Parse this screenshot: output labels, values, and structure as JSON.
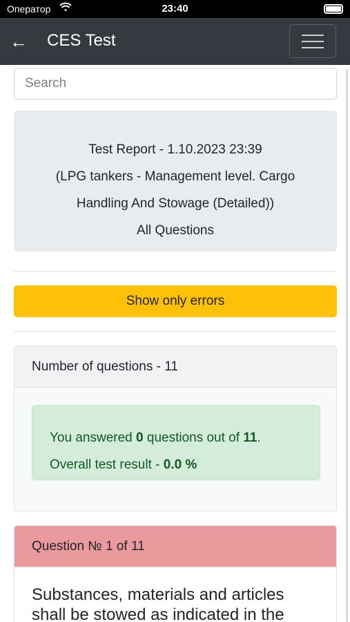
{
  "status_bar": {
    "carrier": "Оператор",
    "time": "23:40"
  },
  "navbar": {
    "back_icon": "←",
    "title": "CES Test"
  },
  "search": {
    "placeholder": "Search",
    "value": ""
  },
  "report": {
    "line1": "Test Report - 1.10.2023 23:39",
    "line2": "(LPG tankers - Management level. Cargo",
    "line3": "Handling And Stowage (Detailed))",
    "line4": "All Questions"
  },
  "errors_button": {
    "label": "Show only errors",
    "color": "#ffc107"
  },
  "summary": {
    "header": "Number of questions - 11",
    "answered_prefix": "You answered ",
    "answered_count": "0",
    "answered_middle": " questions out of ",
    "total_count": "11",
    "answered_suffix": ".",
    "result_prefix": "Overall test result - ",
    "result_value": "0.0 %",
    "success_color": "#d4edda"
  },
  "question": {
    "header": "Question № 1 of 11",
    "text": "Substances, materials and articles shall be stowed as indicated in the",
    "header_color": "#ea9a9c"
  }
}
